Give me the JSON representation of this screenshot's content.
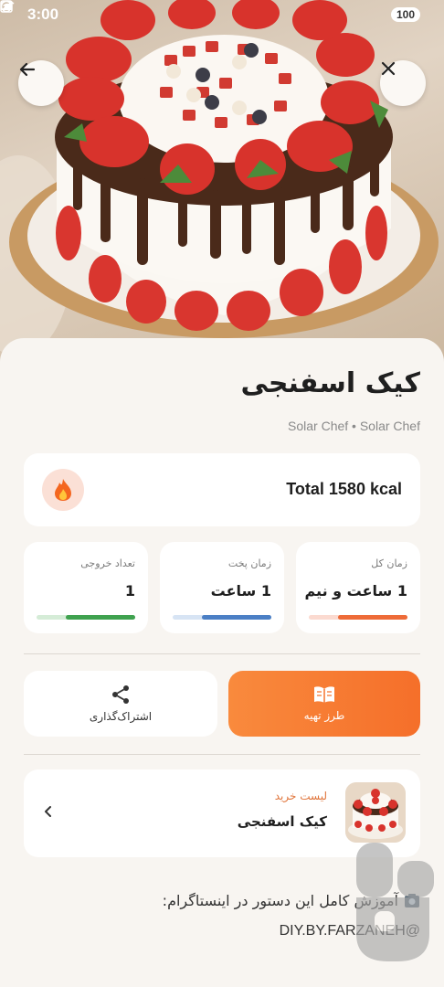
{
  "status_bar": {
    "time": "3:00",
    "battery": "100",
    "icons": [
      "screenshot-icon",
      "camera-icon",
      "wifi-icon",
      "signal-icon"
    ]
  },
  "header": {
    "back_icon": "arrow-left-icon",
    "close_icon": "close-icon"
  },
  "recipe": {
    "title": "کیک اسفنجی",
    "author": "Solar Chef • Solar Chef"
  },
  "calories": {
    "icon": "flame-icon",
    "text": "Total 1580 kcal"
  },
  "stats": [
    {
      "label": "زمان کل",
      "value": "1 ساعت و نیم",
      "progress": 0.7,
      "color": "#ee6b38",
      "track": "#fbdad0"
    },
    {
      "label": "زمان پخت",
      "value": "1 ساعت",
      "progress": 0.7,
      "color": "#4b7fc5",
      "track": "#d7e4f4"
    },
    {
      "label": "تعداد خروجی",
      "value": "1",
      "progress": 0.7,
      "color": "#3fa24f",
      "track": "#d5ecd7"
    }
  ],
  "actions": {
    "prep_label": "طرز تهیه",
    "prep_icon": "book-icon",
    "share_label": "اشتراک‌گذاری",
    "share_icon": "share-icon"
  },
  "shopping": {
    "label": "لیست خرید",
    "name": "کیک اسفنجی",
    "chevron_icon": "chevron-left-icon"
  },
  "instagram": {
    "line1": "آموزش کامل این دستور در اینستاگرام:",
    "icon": "camera-icon",
    "line2": "DIY.BY.FARZANEH@"
  },
  "colors": {
    "accent": "#f5732d",
    "sheet_bg": "#f8f5f1",
    "card_bg": "#ffffff"
  }
}
